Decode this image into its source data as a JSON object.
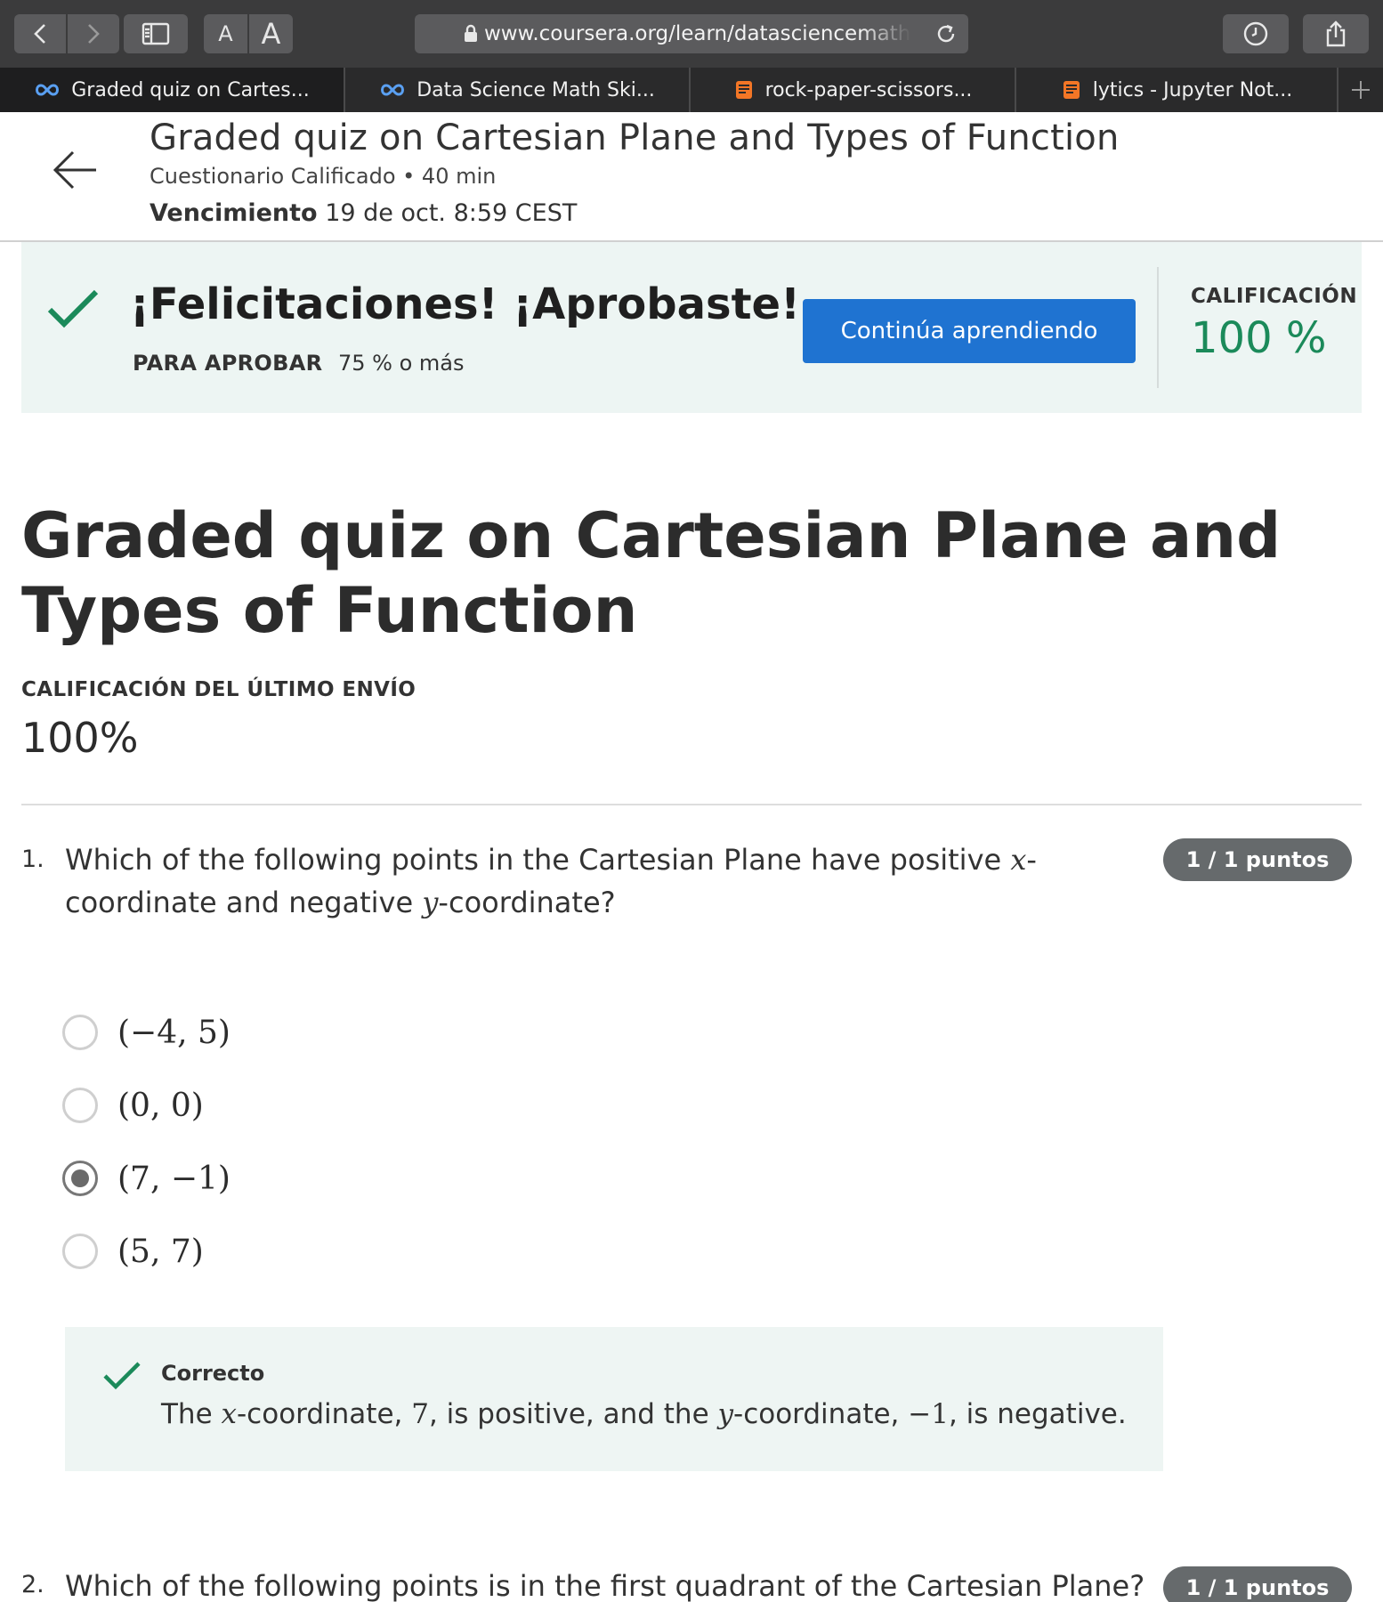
{
  "browser": {
    "url": "www.coursera.org/learn/datasciencemaths",
    "font_small_label": "A",
    "font_large_label": "A",
    "tabs": [
      {
        "label": "Graded quiz on Cartes...",
        "icon": "coursera-infinity-icon",
        "active": true
      },
      {
        "label": "Data Science Math Ski...",
        "icon": "coursera-infinity-icon",
        "active": false
      },
      {
        "label": "rock-paper-scissors...",
        "icon": "jupyter-notebook-icon",
        "active": false
      },
      {
        "label": "lytics - Jupyter Not...",
        "icon": "jupyter-notebook-icon",
        "active": false
      }
    ]
  },
  "header": {
    "title": "Graded quiz on Cartesian Plane and Types of Function",
    "subtitle": "Cuestionario Calificado • 40 min",
    "due_label": "Vencimiento",
    "due_value": "19 de oct. 8:59 CEST"
  },
  "banner": {
    "title": "¡Felicitaciones! ¡Aprobaste!",
    "pass_label": "PARA APROBAR",
    "pass_value": "75 % o más",
    "button_label": "Continúa aprendiendo",
    "grade_label": "CALIFICACIÓN",
    "grade_value": "100 %"
  },
  "main": {
    "title": "Graded quiz on Cartesian Plane and Types of Function",
    "last_submission_label": "CALIFICACIÓN DEL ÚLTIMO ENVÍO",
    "last_submission_value": "100%"
  },
  "questions": [
    {
      "number": "1.",
      "text_parts": [
        "Which of the following points in the Cartesian Plane have positive ",
        "x",
        "-coordinate and negative ",
        "y",
        "-coordinate?"
      ],
      "points": "1 / 1 puntos",
      "options": [
        {
          "label": "(−4, 5)",
          "selected": false
        },
        {
          "label": "(0, 0)",
          "selected": false
        },
        {
          "label": "(7, −1)",
          "selected": true
        },
        {
          "label": "(5, 7)",
          "selected": false
        }
      ],
      "feedback": {
        "title": "Correcto",
        "text_parts": [
          "The ",
          "x",
          "-coordinate, ",
          "7",
          ", is positive, and the ",
          "y",
          "-coordinate, ",
          "−1",
          ", is negative."
        ]
      }
    },
    {
      "number": "2.",
      "text": "Which of the following points is in the first quadrant of the Cartesian Plane?",
      "points": "1 / 1 puntos"
    }
  ],
  "colors": {
    "accent_blue": "#1f73d1",
    "success_green": "#1b8a5a",
    "banner_bg": "#edf5f3",
    "badge_gray": "#666a6c"
  }
}
